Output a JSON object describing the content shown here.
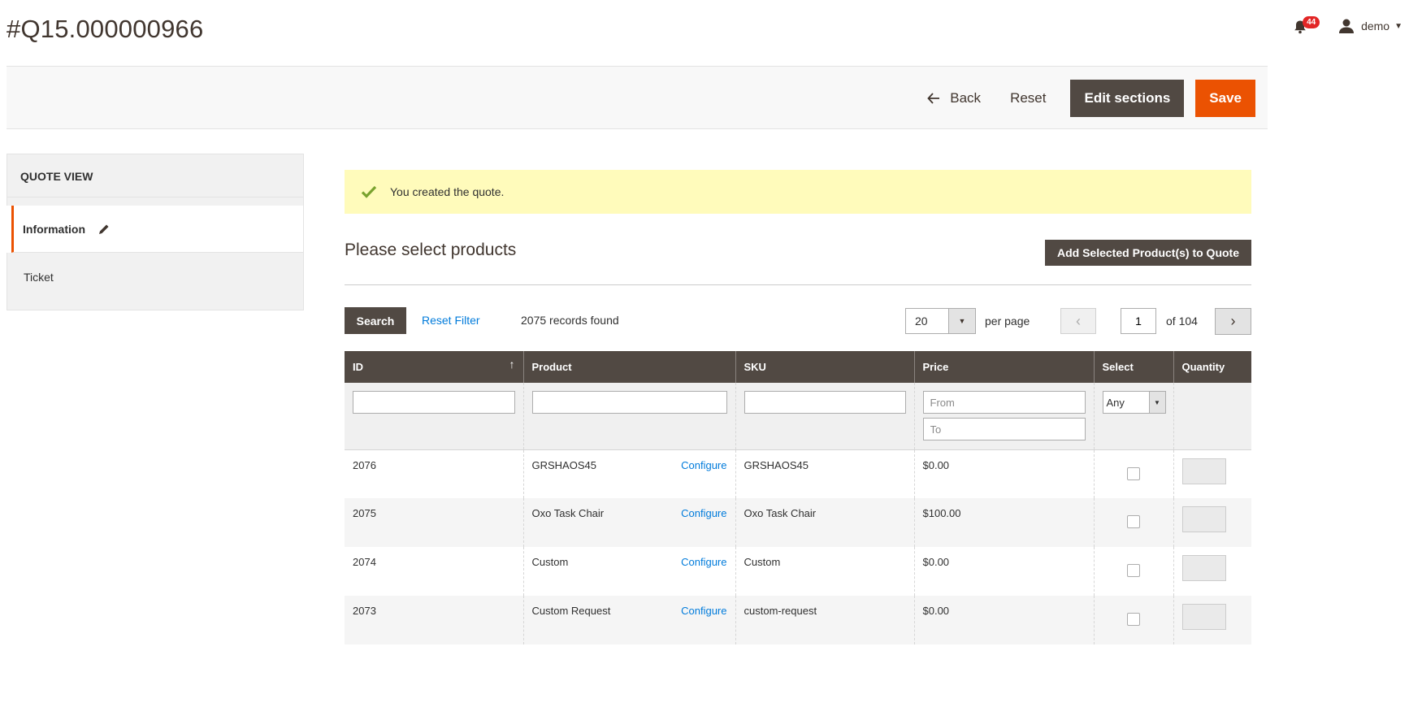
{
  "header": {
    "title": "#Q15.000000966",
    "notification_count": "44",
    "user_name": "demo"
  },
  "action_bar": {
    "back_label": "Back",
    "reset_label": "Reset",
    "edit_sections_label": "Edit sections",
    "save_label": "Save"
  },
  "sidebar": {
    "title": "QUOTE VIEW",
    "items": [
      {
        "label": "Information",
        "active": true
      },
      {
        "label": "Ticket",
        "active": false
      }
    ]
  },
  "message": {
    "text": "You created the quote."
  },
  "products": {
    "section_title": "Please select products",
    "add_button_label": "Add Selected Product(s) to Quote",
    "search_label": "Search",
    "reset_filter_label": "Reset Filter",
    "records_found": "2075 records found",
    "per_page_value": "20",
    "per_page_label": "per page",
    "current_page": "1",
    "total_pages_text": "of 104"
  },
  "grid": {
    "columns": [
      "ID",
      "Product",
      "SKU",
      "Price",
      "Select",
      "Quantity"
    ],
    "filters": {
      "price_from_placeholder": "From",
      "price_to_placeholder": "To",
      "select_value": "Any"
    },
    "configure_label": "Configure",
    "rows": [
      {
        "id": "2076",
        "product": "GRSHAOS45",
        "sku": "GRSHAOS45",
        "price": "$0.00"
      },
      {
        "id": "2075",
        "product": "Oxo Task Chair",
        "sku": "Oxo Task Chair",
        "price": "$100.00"
      },
      {
        "id": "2074",
        "product": "Custom",
        "sku": "Custom",
        "price": "$0.00"
      },
      {
        "id": "2073",
        "product": "Custom Request",
        "sku": "custom-request",
        "price": "$0.00"
      }
    ]
  },
  "colors": {
    "accent": "#eb5202",
    "dark_button": "#514943",
    "link": "#007bdb",
    "message_bg": "#fffbbb"
  }
}
